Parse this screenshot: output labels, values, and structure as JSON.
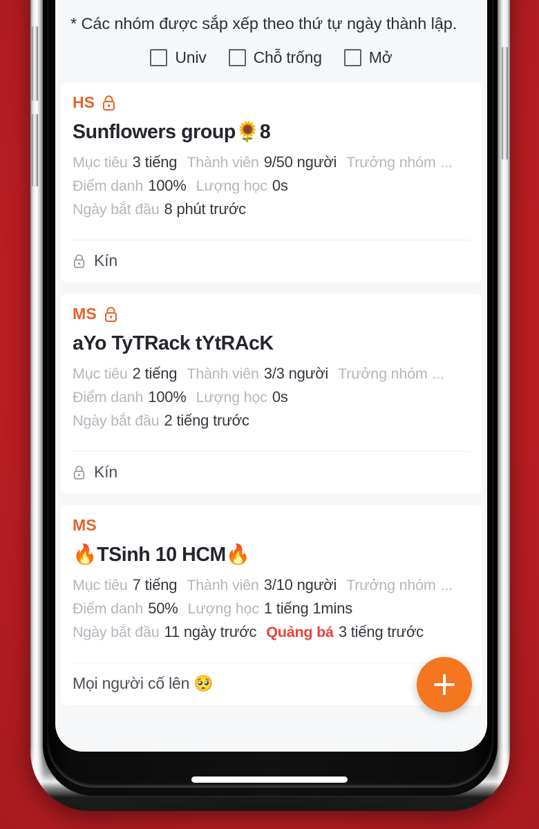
{
  "theme": {
    "backdrop_red": "#C42025",
    "accent_orange": "#E8622A",
    "fab_orange": "#F4761F",
    "promo_red": "#E8433C",
    "screen_bg": "#F6F7F8",
    "card_bg": "#FFFFFF",
    "label_gray": "#B3B7BD",
    "value_dark": "#33373D"
  },
  "header": {
    "note": "* Các nhóm được sắp xếp theo thứ tự ngày thành lập.",
    "filters": [
      {
        "label": "Univ",
        "checked": false
      },
      {
        "label": "Chỗ trống",
        "checked": false
      },
      {
        "label": "Mở",
        "checked": false
      }
    ]
  },
  "cards": [
    {
      "badge": "HS",
      "has_lock_badge": true,
      "title": "Sunflowers group🌻8",
      "meta": {
        "goal_label": "Mục tiêu",
        "goal_value": "3 tiếng",
        "members_label": "Thành viên",
        "members_value": "9/50 người",
        "leader_label": "Trưởng nhóm",
        "leader_value": "...",
        "attendance_label": "Điểm danh",
        "attendance_value": "100%",
        "studytime_label": "Lượng học",
        "studytime_value": "0s",
        "startdate_label": "Ngày bắt đầu",
        "startdate_value": "8 phút trước",
        "promo_label": "",
        "promo_value": ""
      },
      "footer": {
        "has_lock": true,
        "text": "Kín"
      }
    },
    {
      "badge": "MS",
      "has_lock_badge": true,
      "title": "aYo TyTRack tYtRAcK",
      "meta": {
        "goal_label": "Mục tiêu",
        "goal_value": "2 tiếng",
        "members_label": "Thành viên",
        "members_value": "3/3 người",
        "leader_label": "Trưởng nhóm",
        "leader_value": "...",
        "attendance_label": "Điểm danh",
        "attendance_value": "100%",
        "studytime_label": "Lượng học",
        "studytime_value": "0s",
        "startdate_label": "Ngày bắt đầu",
        "startdate_value": "2 tiếng trước",
        "promo_label": "",
        "promo_value": ""
      },
      "footer": {
        "has_lock": true,
        "text": "Kín"
      }
    },
    {
      "badge": "MS",
      "has_lock_badge": false,
      "title": "🔥TSinh 10 HCM🔥",
      "meta": {
        "goal_label": "Mục tiêu",
        "goal_value": "7 tiếng",
        "members_label": "Thành viên",
        "members_value": "3/10 người",
        "leader_label": "Trưởng nhóm",
        "leader_value": "...",
        "attendance_label": "Điểm danh",
        "attendance_value": "50%",
        "studytime_label": "Lượng học",
        "studytime_value": "1 tiếng 1mins",
        "startdate_label": "Ngày bắt đầu",
        "startdate_value": "11 ngày trước",
        "promo_label": "Quảng bá",
        "promo_value": "3 tiếng trước"
      },
      "footer": {
        "has_lock": false,
        "text": "Mọi người cố lên 🥺"
      }
    }
  ],
  "fab": {
    "label": "+",
    "icon": "plus-icon"
  }
}
